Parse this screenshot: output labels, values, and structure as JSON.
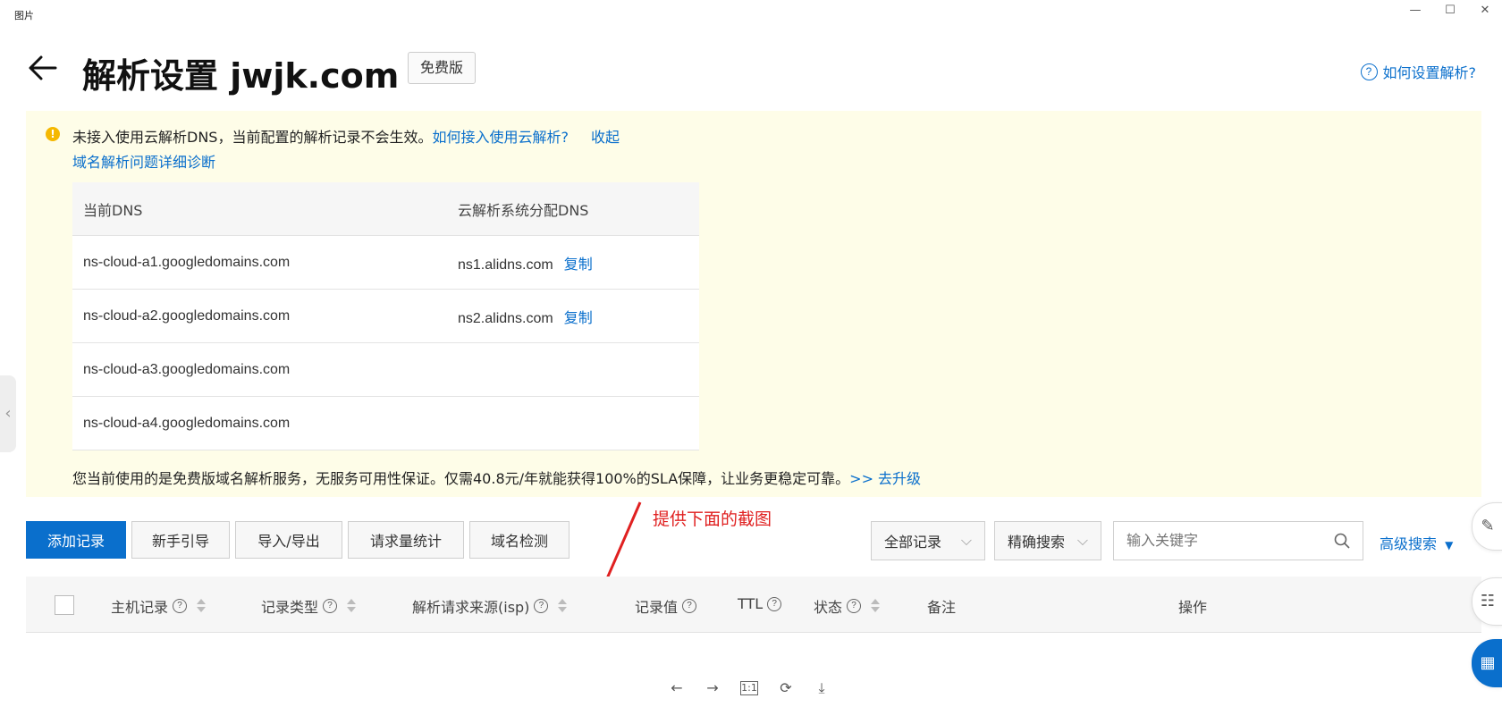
{
  "window": {
    "title": "图片",
    "minimize": "—",
    "maximize": "☐",
    "close": "✕"
  },
  "header": {
    "title": "解析设置 jwjk.com",
    "badge": "免费版",
    "help_link": "如何设置解析?"
  },
  "notice": {
    "text": "未接入使用云解析DNS，当前配置的解析记录不会生效。",
    "how_link": "如何接入使用云解析?",
    "collapse_link": "收起",
    "diagnose_link": "域名解析问题详细诊断",
    "table": {
      "headers": [
        "当前DNS",
        "云解析系统分配DNS"
      ],
      "rows": [
        {
          "current": "ns-cloud-a1.googledomains.com",
          "assigned": "ns1.alidns.com",
          "action": "复制"
        },
        {
          "current": "ns-cloud-a2.googledomains.com",
          "assigned": "ns2.alidns.com",
          "action": "复制"
        },
        {
          "current": "ns-cloud-a3.googledomains.com",
          "assigned": "",
          "action": ""
        },
        {
          "current": "ns-cloud-a4.googledomains.com",
          "assigned": "",
          "action": ""
        }
      ]
    },
    "footer_text": "您当前使用的是免费版域名解析服务，无服务可用性保证。仅需40.8元/年就能获得100%的SLA保障，让业务更稳定可靠。",
    "upgrade_link": ">> 去升级"
  },
  "toolbar": {
    "add_record": "添加记录",
    "guide": "新手引导",
    "import_export": "导入/导出",
    "request_stats": "请求量统计",
    "domain_check": "域名检测",
    "all_records": "全部记录",
    "exact_search": "精确搜索",
    "search_placeholder": "输入关键字",
    "advanced_search": "高级搜索"
  },
  "annotation": "提供下面的截图",
  "records_table": {
    "headers": {
      "host": "主机记录",
      "type": "记录类型",
      "isp": "解析请求来源(isp)",
      "value": "记录值",
      "ttl": "TTL",
      "status": "状态",
      "remark": "备注",
      "action": "操作"
    }
  },
  "viewer_toolbar": {
    "prev": "←",
    "next": "→",
    "actual_size": "1:1",
    "rotate": "⟳",
    "download": "⤓"
  },
  "colors": {
    "accent": "#0a6fcc",
    "notice_bg": "#fefde8",
    "annotation": "#e02020"
  }
}
